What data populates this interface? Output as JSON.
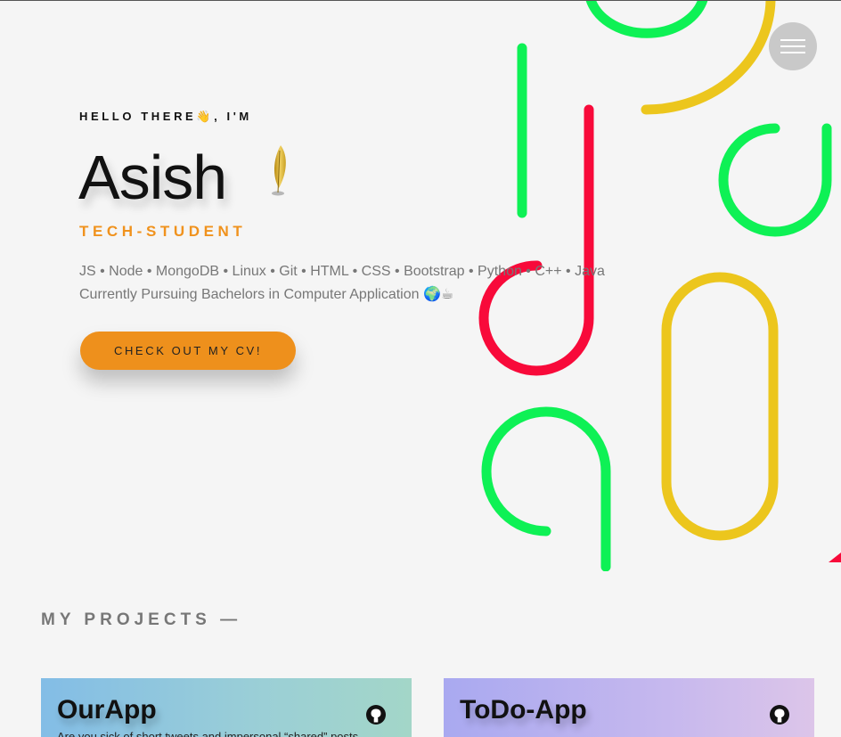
{
  "nav": {
    "menu_icon": "hamburger-menu-icon"
  },
  "hero": {
    "greeting": "HELLO THERE👋, I'M",
    "name": "Asish",
    "name_icon": "feather-icon",
    "role": "TECH-STUDENT",
    "skills": "JS • Node • MongoDB • Linux • Git • HTML • CSS • Bootstrap • Python • C++ • Java",
    "bio": "Currently Pursuing Bachelors in Computer Application 🌍☕",
    "cv_button": "CHECK OUT MY CV!"
  },
  "projects": {
    "section_title": "MY PROJECTS —",
    "items": [
      {
        "title": "OurApp",
        "description": "Are you sick of short tweets and impersonal “shared” posts",
        "icon": "github-icon"
      },
      {
        "title": "ToDo-App",
        "description": "",
        "icon": "github-icon"
      }
    ]
  },
  "colors": {
    "accent": "#ee901c",
    "deco_green": "#0ef155",
    "deco_yellow": "#ecc61d",
    "deco_red": "#f80a3a",
    "background": "#f5f5f5"
  }
}
